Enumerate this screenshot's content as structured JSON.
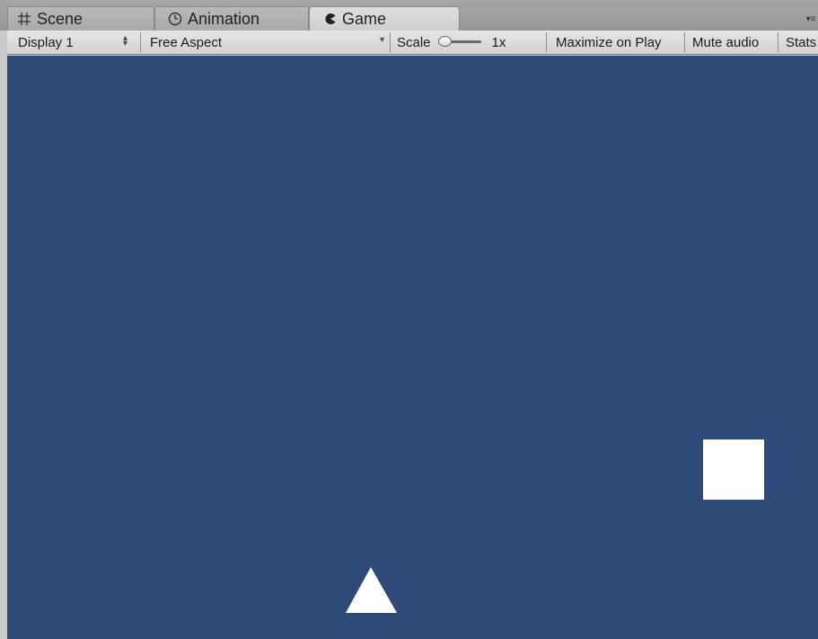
{
  "tabs": {
    "scene": {
      "label": "Scene",
      "icon": "grid-hash-icon"
    },
    "animation": {
      "label": "Animation",
      "icon": "clock-icon"
    },
    "game": {
      "label": "Game",
      "icon": "pacman-icon",
      "active": true
    },
    "menu_icon": "tab-menu-icon"
  },
  "toolbar": {
    "display_label": "Display 1",
    "aspect_label": "Free Aspect",
    "scale_label": "Scale",
    "scale_value": "1x",
    "maximize_label": "Maximize on Play",
    "mute_label": "Mute audio",
    "stats_label": "Stats"
  },
  "game_view": {
    "background_color": "#2e4a78",
    "objects": [
      {
        "name": "square-sprite",
        "shape": "square",
        "color": "#ffffff"
      },
      {
        "name": "triangle-sprite",
        "shape": "triangle",
        "color": "#ffffff"
      }
    ]
  }
}
